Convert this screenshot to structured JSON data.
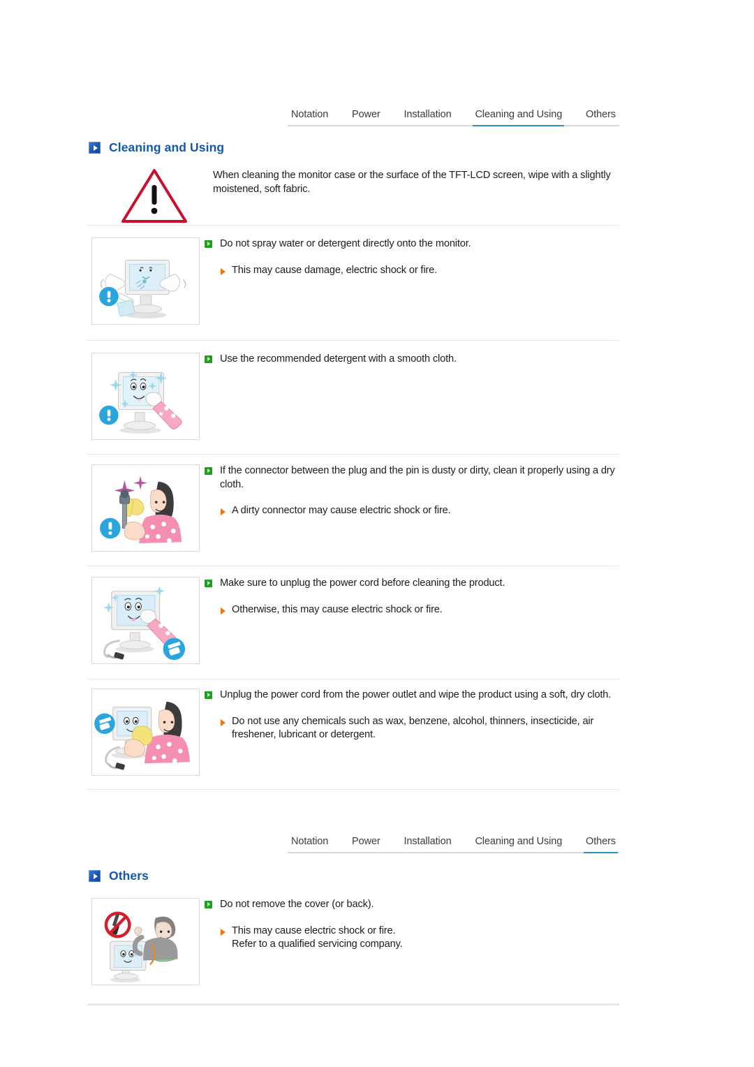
{
  "document": {
    "title": "Cleaning and Using",
    "accent_blue": "#1458a8",
    "tab_active_underline": "#2d8fc4",
    "bullet_green": "#19a319",
    "bullet_orange": "#ef7512",
    "warning_red": "#c8102e"
  },
  "tabbar_top": {
    "tabs": [
      {
        "label": "Notation",
        "active": false
      },
      {
        "label": "Power",
        "active": false
      },
      {
        "label": "Installation",
        "active": false
      },
      {
        "label": "Cleaning and Using",
        "active": true
      },
      {
        "label": "Others",
        "active": false
      }
    ]
  },
  "tabbar_bottom": {
    "tabs": [
      {
        "label": "Notation",
        "active": false
      },
      {
        "label": "Power",
        "active": false
      },
      {
        "label": "Installation",
        "active": false
      },
      {
        "label": "Cleaning and Using",
        "active": false
      },
      {
        "label": "Others",
        "active": true
      }
    ]
  },
  "section_cleaning": {
    "heading": "Cleaning and Using",
    "icon": "blue-arrow-square-icon",
    "intro": {
      "icon": "warning-triangle-icon",
      "text": "When cleaning the monitor case or the surface of the TFT-LCD screen, wipe with a slightly moistened, soft fabric."
    },
    "items": [
      {
        "illustration": "monitor-spray-bottle-icon",
        "main": "Do not spray water or detergent directly onto the monitor.",
        "subs": [
          "This may cause damage, electric shock or fire."
        ]
      },
      {
        "illustration": "monitor-wipe-cloth-icon",
        "main": "Use the recommended detergent with a smooth cloth.",
        "subs": []
      },
      {
        "illustration": "person-cleaning-plug-icon",
        "main": "If the connector between the plug and the pin is dusty or dirty, clean it properly using a dry cloth.",
        "subs": [
          "A dirty connector may cause electric shock or fire."
        ]
      },
      {
        "illustration": "monitor-unplug-cord-icon",
        "main": "Make sure to unplug the power cord before cleaning the product.",
        "subs": [
          "Otherwise, this may cause electric shock or fire."
        ]
      },
      {
        "illustration": "person-unplug-wipe-icon",
        "main": "Unplug the power cord from the power outlet and wipe the product using a soft, dry cloth.",
        "subs": [
          "Do not use any chemicals such as wax, benzene, alcohol, thinners, insecticide, air freshener, lubricant or detergent."
        ]
      }
    ]
  },
  "section_others": {
    "heading": "Others",
    "icon": "blue-arrow-square-icon",
    "items": [
      {
        "illustration": "no-screwdriver-cover-icon",
        "main": "Do not remove the cover (or back).",
        "subs": [
          "This may cause electric shock or fire.",
          "Refer to a qualified servicing company."
        ]
      }
    ]
  }
}
